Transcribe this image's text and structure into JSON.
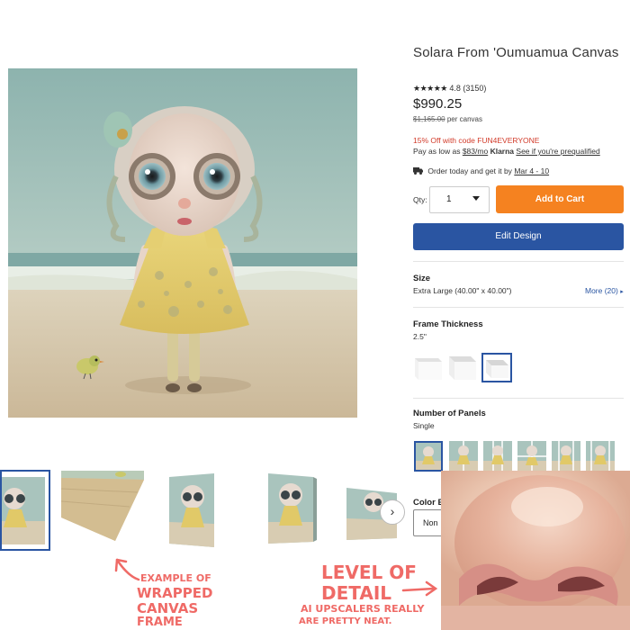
{
  "product": {
    "title": "Solara From 'Oumuamua Canvas",
    "stars": "★★★★★",
    "rating": "4.8 (3150)",
    "price": "$990.25",
    "original_price": "$1,165.00",
    "per_unit": "per canvas",
    "promo": "15% Off with code FUN4EVERYONE",
    "klarna_prefix": "Pay as low as",
    "klarna_amount": "$83/mo",
    "klarna_brand": "Klarna",
    "klarna_link": "See if you're prequalified",
    "shipping_prefix": "Order today and get it by",
    "shipping_dates": "Mar 4 - 10"
  },
  "purchase": {
    "qty_label": "Qty:",
    "qty_value": "1",
    "add_to_cart": "Add to Cart",
    "edit_design": "Edit Design"
  },
  "options": {
    "size_label": "Size",
    "size_value": "Extra Large (40.00\" x 40.00\")",
    "size_more": "More (20)",
    "frame_label": "Frame Thickness",
    "frame_value": "2.5\"",
    "panels_label": "Number of Panels",
    "panels_value": "Single",
    "color_label": "Color E",
    "color_value": "Non"
  },
  "annotations": {
    "wrapped": [
      "EXAMPLE OF",
      "WRAPPED",
      "CANVAS",
      "FRAME"
    ],
    "detail": [
      "LEVEL OF",
      "DETAIL"
    ],
    "ai_note": [
      "AI UPSCALERS REALLY",
      "ARE PRETTY NEAT."
    ]
  },
  "icons": {
    "truck": "truck-icon",
    "next": "chevron-right-icon",
    "caret": "caret-down-icon"
  },
  "colors": {
    "add_to_cart": "#f58220",
    "edit_design": "#2a55a2",
    "promo": "#d23b2a",
    "annotation": "#ef6a66"
  }
}
